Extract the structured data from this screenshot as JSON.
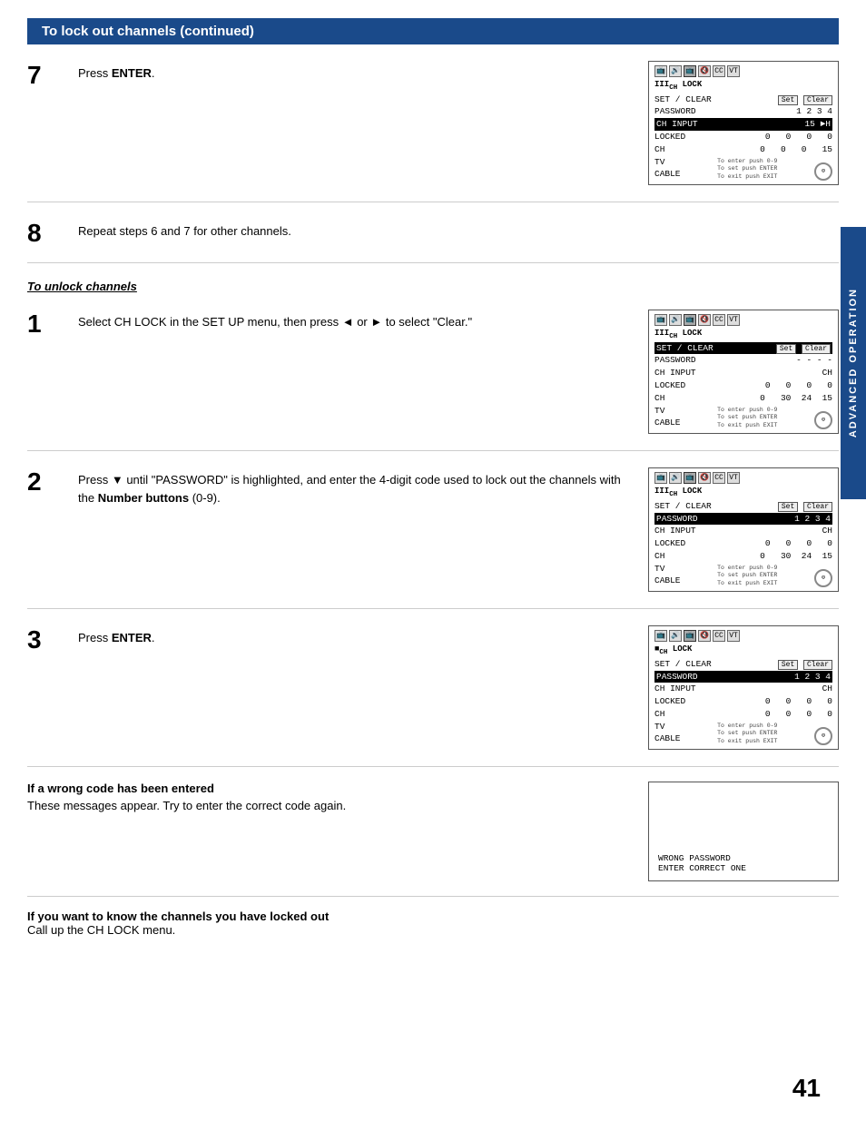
{
  "header": {
    "title": "To lock out channels (continued)"
  },
  "sidebar": {
    "label": "ADVANCED OPERATION"
  },
  "page_number": "41",
  "steps_section1": [
    {
      "number": "7",
      "text": "Press ",
      "text_bold": "ENTER",
      "text_after": ".",
      "has_screen": true
    },
    {
      "number": "8",
      "text": "Repeat steps 6 and 7 for other channels.",
      "has_screen": false
    }
  ],
  "unlock_heading": "To unlock channels",
  "steps_section2": [
    {
      "number": "1",
      "text_pre": "Select CH LOCK in the SET  UP menu, then press  ◄ or ► to select \"Clear.\"",
      "has_screen": true
    },
    {
      "number": "2",
      "text_pre": "Press ▼ until \"PASSWORD\" is highlighted, and enter the 4-digit code used to lock out the channels with the ",
      "text_bold": "Number buttons",
      "text_after": " (0-9).",
      "has_screen": true
    },
    {
      "number": "3",
      "text_pre": "Press ",
      "text_bold": "ENTER",
      "text_after": ".",
      "has_screen": true
    }
  ],
  "wrong_code": {
    "heading": "If a wrong code has been entered",
    "text": "These messages appear. Try to enter the correct code again.",
    "screen_line1": "WRONG  PASSWORD",
    "screen_line2": "ENTER  CORRECT  ONE"
  },
  "bottom_note": {
    "heading_bold": "If you want to know the channels you have locked out",
    "text": "Call up the CH LOCK menu."
  },
  "screens": {
    "step7": {
      "icons_row": "◼ ◀◀ ◀◼ ◀)) ◼◼ ◼◼",
      "title": "IIICH LOCK",
      "row_set_clear": "SET / CLEAR",
      "btn_set": "Set",
      "btn_clear": "Clear",
      "row_password": "PASSWORD",
      "password_val": "1 2 3 4",
      "row_ch_input_label": "CH  INPUT",
      "ch_input_val": "15 ►H",
      "row_locked": "LOCKED    0    0    0    0",
      "row_ch": "CH        0    0    0   15",
      "row_tv": "TV",
      "row_cable": "CABLE",
      "footer_left": "To enter push 0-9\nTo set push ENTER\nTo exit push EXIT",
      "highlight_row": "ch_input"
    },
    "unlock1": {
      "title": "IIICH LOCK",
      "row_set_clear": "SET / CLEAR",
      "btn_set": "Set",
      "btn_clear": "Clear",
      "row_password": "PASSWORD",
      "password_val": "- - - -",
      "row_ch_input_label": "CH  INPUT",
      "ch_input_val": "CH",
      "row_locked": "LOCKED    0    0    0    0",
      "row_ch": "CH        0   30   24   15",
      "row_tv": "TV",
      "row_cable": "CABLE",
      "highlight_row": "set_clear"
    },
    "unlock2": {
      "title": "IIICH LOCK",
      "row_set_clear": "SET / CLEAR",
      "btn_set": "Set",
      "btn_clear": "Clear",
      "row_password": "PASSWORD",
      "password_val": "1 2 3 4",
      "row_ch_input_label": "CH  INPUT",
      "ch_input_val": "CH",
      "row_locked": "LOCKED    0    0    0    0",
      "row_ch": "CH        0   30   24   15",
      "row_tv": "TV",
      "row_cable": "CABLE",
      "highlight_row": "password"
    },
    "unlock3": {
      "title": "■CH LOCK",
      "row_set_clear": "SET / CLEAR",
      "btn_set": "Set",
      "btn_clear": "Clear",
      "row_password": "PASSWORD",
      "password_val": "1 2 3 4",
      "row_ch_input_label": "CH  INPUT",
      "ch_input_val": "CH",
      "row_locked": "LOCKED    0    0    0    0",
      "row_ch": "CH        0    0    0    0",
      "row_tv": "TV",
      "row_cable": "CABLE",
      "highlight_row": "password"
    }
  }
}
